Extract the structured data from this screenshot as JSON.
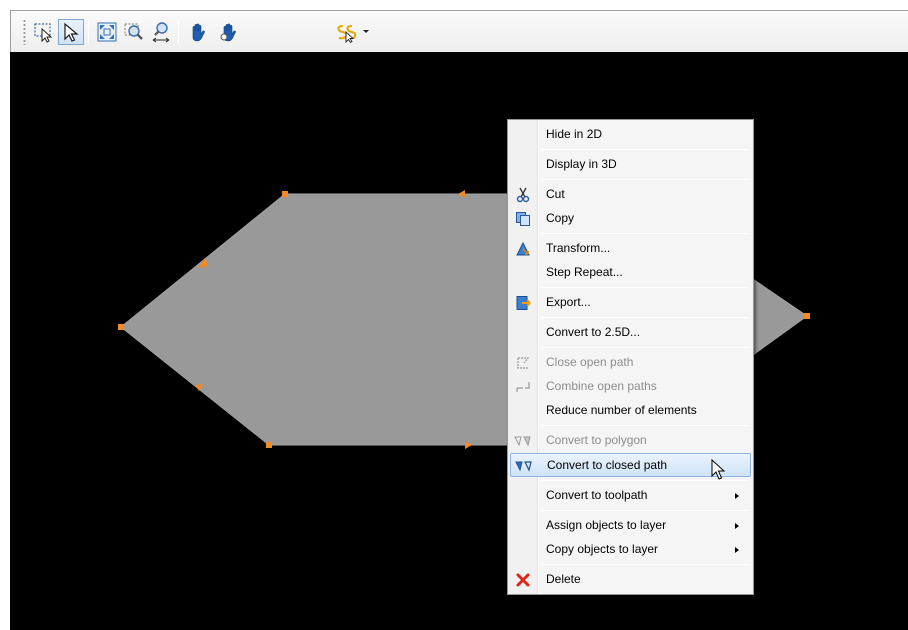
{
  "toolbar": {
    "buttons": [
      {
        "icon": "select-region-icon",
        "pressed": false
      },
      {
        "icon": "select-arrow-icon",
        "pressed": true
      },
      {
        "icon": "zoom-extents-icon",
        "pressed": false
      },
      {
        "icon": "zoom-window-icon",
        "pressed": false
      },
      {
        "icon": "zoom-pan-icon",
        "pressed": false
      },
      {
        "icon": "pan-hand-icon",
        "pressed": false
      },
      {
        "icon": "pan-hand-alt-icon",
        "pressed": false
      },
      {
        "icon": "snap-options-icon",
        "pressed": false
      }
    ]
  },
  "canvas": {
    "background": "#000000",
    "shape_fill": "#999999",
    "node_color": "#f08a24"
  },
  "context_menu": {
    "items": {
      "hide_2d": "Hide in 2D",
      "display_3d": "Display in 3D",
      "cut": "Cut",
      "copy": "Copy",
      "transform": "Transform...",
      "step_repeat": "Step Repeat...",
      "export": "Export...",
      "convert_25d": "Convert to 2.5D...",
      "close_open_path": "Close open path",
      "combine_open_paths": "Combine open paths",
      "reduce_elements": "Reduce number of elements",
      "convert_polygon": "Convert to polygon",
      "convert_closed_path": "Convert to closed path",
      "convert_toolpath": "Convert to toolpath",
      "assign_layer": "Assign objects to layer",
      "copy_layer": "Copy objects to layer",
      "delete": "Delete"
    },
    "highlighted_item": "Convert to closed path",
    "disabled_items": [
      "Close open path",
      "Combine open paths",
      "Convert to polygon"
    ]
  }
}
